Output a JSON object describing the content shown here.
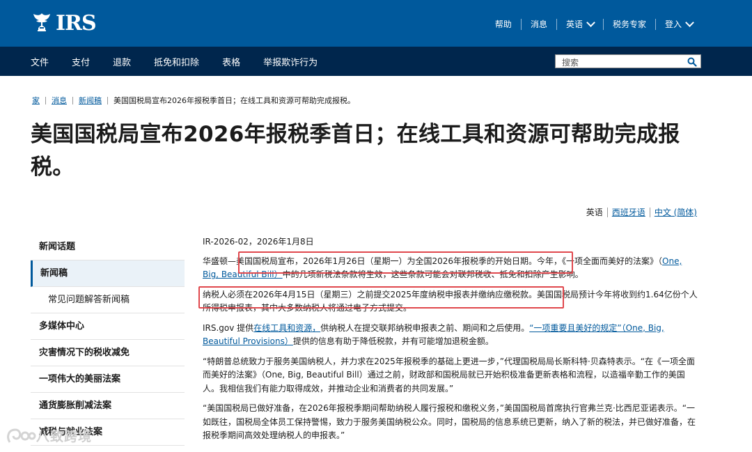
{
  "header": {
    "logo_text": "IRS",
    "utility": [
      {
        "label": "帮助"
      },
      {
        "label": "消息"
      },
      {
        "label": "英语"
      },
      {
        "label": "税务专家"
      },
      {
        "label": "登入"
      }
    ]
  },
  "nav": {
    "items": [
      "文件",
      "支付",
      "退款",
      "抵免和扣除",
      "表格",
      "举报欺诈行为"
    ],
    "search_placeholder": "搜索"
  },
  "breadcrumb": [
    "家",
    "消息",
    "新闻稿",
    "美国国税局宣布2026年报税季首日；在线工具和资源可帮助完成报税。"
  ],
  "title": "美国国税局宣布2026年报税季首日；在线工具和资源可帮助完成报税。",
  "languages": [
    "英语",
    "西班牙语",
    "中文 (简体)"
  ],
  "sidebar": [
    {
      "label": "新闻话题"
    },
    {
      "label": "新闻稿"
    },
    {
      "label": "常见问题解答新闻稿"
    },
    {
      "label": "多媒体中心"
    },
    {
      "label": "灾害情况下的税收减免"
    },
    {
      "label": "一项伟大的美丽法案"
    },
    {
      "label": "通货膨胀削减法案"
    },
    {
      "label": "减税与就业法案"
    }
  ],
  "article": {
    "dateline": "IR-2026-02，2026年1月8日",
    "p1": {
      "a": "华盛顿—",
      "hl": "美国国税局宣布，2026年1月26日（星期一）为全国2026年报税季的开始日期。",
      "b": "今年，《一项全面而美好的法案》（",
      "link": "One, Big, Beautiful Bill）",
      "c": "中的几项新税法条款将生效，这些条款可能会对联邦税收、抵免和扣除产生影响。"
    },
    "p2": {
      "hl": "纳税人必须在2026年4月15日（星期三）之前提交2025年度纳税申报表并缴纳应缴税款。",
      "b": "美国国税局预计今年将收到约1.64亿份个人所得税申报表，其中大多数纳税人将通过电子方式提交。"
    },
    "p3": {
      "a": "IRS.gov 提供",
      "link1": "在线工具和资源，",
      "b": "供纳税人在提交联邦纳税申报表之前、期间和之后使用。",
      "link2": "“一项重要且美好的规定”（One, Big, Beautiful Provisions）",
      "c": "提供的信息有助于降低税款，并有可能增加退税金额。"
    },
    "p4": "“特朗普总统致力于服务美国纳税人，并力求在2025年报税季的基础上更进一步，”代理国税局局长斯科特·贝森特表示。“在《一项全面而美好的法案》（One, Big, Beautiful Bill）通过之前，财政部和国税局就已开始积极准备更新表格和流程，以造福辛勤工作的美国人。我相信我们有能力取得成效，并推动企业和消费者的共同发展。”",
    "p5": "“美国国税局已做好准备，在2026年报税季期间帮助纳税人履行报税和缴税义务，”美国国税局首席执行官弗兰克·比西尼亚诺表示。“一如既往，国税局全体员工保持警惕，致力于服务美国纳税公众。同时，国税局的信息系统已更新，纳入了新的税法，并已做好准备，在报税季期间高效处理纳税人的申报表。”"
  },
  "watermark": "八致跨境",
  "colors": {
    "header_blue": "#00599c",
    "nav_navy": "#00264d",
    "link": "#00599c",
    "highlight_red": "#e0474c"
  }
}
